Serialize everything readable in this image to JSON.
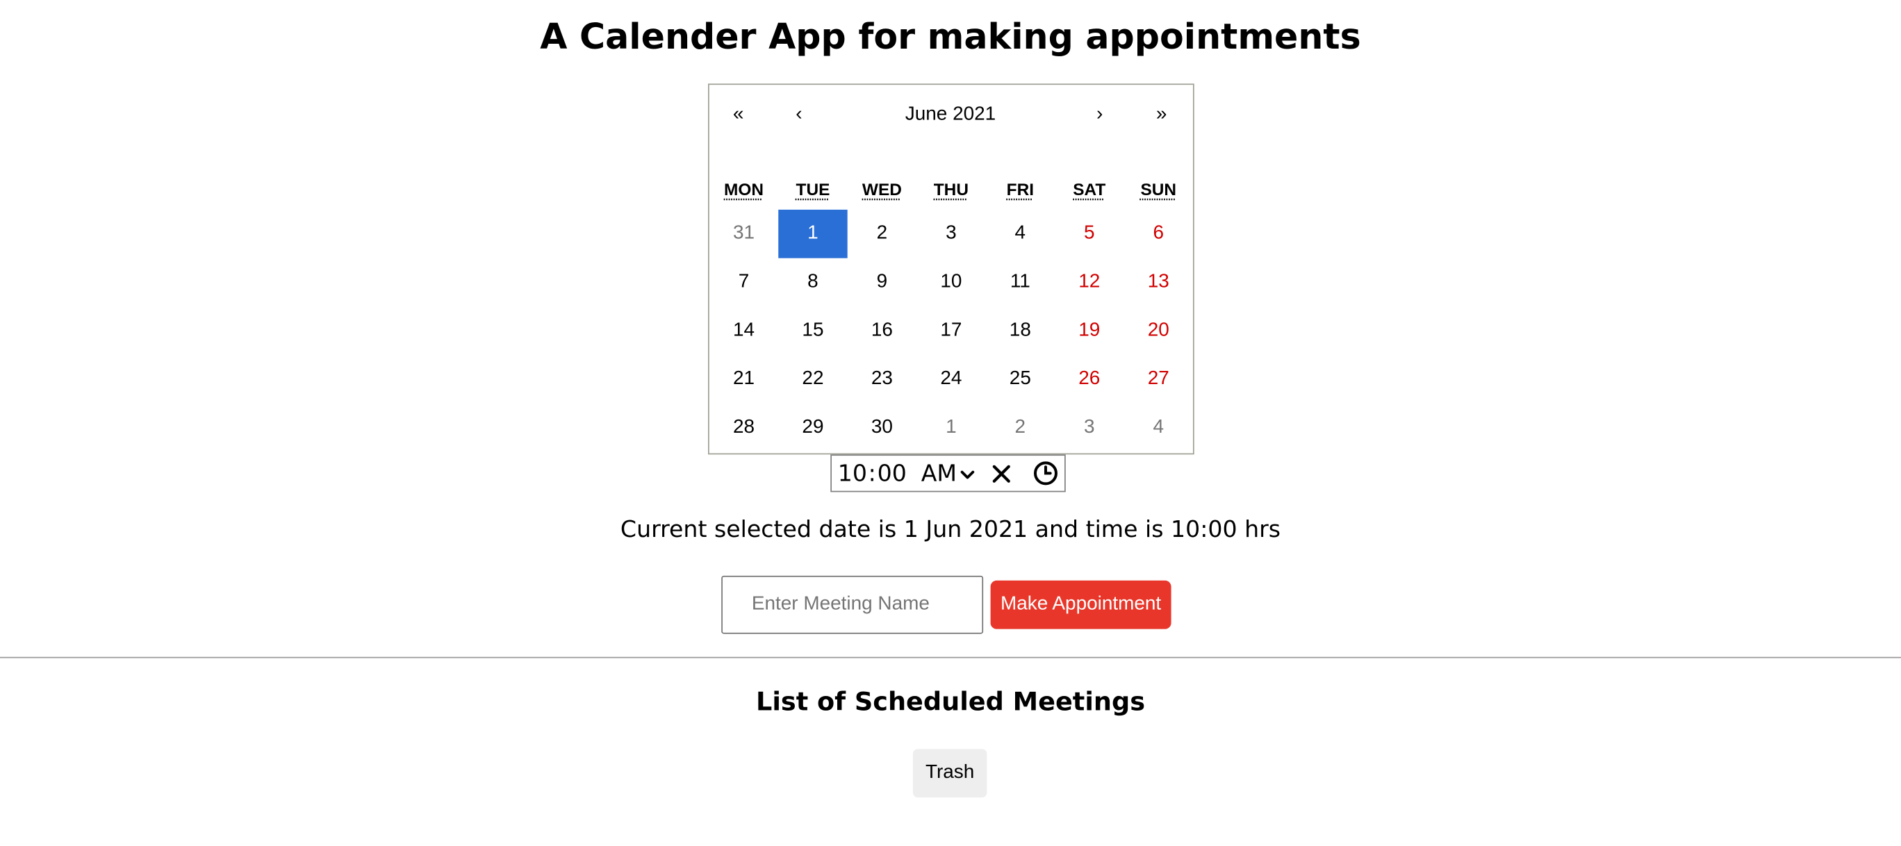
{
  "page": {
    "title": "A Calender App for making appointments"
  },
  "calendar": {
    "nav": {
      "prev2": "«",
      "prev": "‹",
      "label": "June 2021",
      "next": "›",
      "next2": "»"
    },
    "weekdays": [
      "MON",
      "TUE",
      "WED",
      "THU",
      "FRI",
      "SAT",
      "SUN"
    ],
    "weeks": [
      [
        {
          "label": "31",
          "kind": "neighbor"
        },
        {
          "label": "1",
          "kind": "selected"
        },
        {
          "label": "2",
          "kind": "normal"
        },
        {
          "label": "3",
          "kind": "normal"
        },
        {
          "label": "4",
          "kind": "normal"
        },
        {
          "label": "5",
          "kind": "weekend"
        },
        {
          "label": "6",
          "kind": "weekend"
        }
      ],
      [
        {
          "label": "7",
          "kind": "normal"
        },
        {
          "label": "8",
          "kind": "normal"
        },
        {
          "label": "9",
          "kind": "normal"
        },
        {
          "label": "10",
          "kind": "normal"
        },
        {
          "label": "11",
          "kind": "normal"
        },
        {
          "label": "12",
          "kind": "weekend"
        },
        {
          "label": "13",
          "kind": "weekend"
        }
      ],
      [
        {
          "label": "14",
          "kind": "normal"
        },
        {
          "label": "15",
          "kind": "normal"
        },
        {
          "label": "16",
          "kind": "normal"
        },
        {
          "label": "17",
          "kind": "normal"
        },
        {
          "label": "18",
          "kind": "normal"
        },
        {
          "label": "19",
          "kind": "weekend"
        },
        {
          "label": "20",
          "kind": "weekend"
        }
      ],
      [
        {
          "label": "21",
          "kind": "normal"
        },
        {
          "label": "22",
          "kind": "normal"
        },
        {
          "label": "23",
          "kind": "normal"
        },
        {
          "label": "24",
          "kind": "normal"
        },
        {
          "label": "25",
          "kind": "normal"
        },
        {
          "label": "26",
          "kind": "weekend"
        },
        {
          "label": "27",
          "kind": "weekend"
        }
      ],
      [
        {
          "label": "28",
          "kind": "normal"
        },
        {
          "label": "29",
          "kind": "normal"
        },
        {
          "label": "30",
          "kind": "normal"
        },
        {
          "label": "1",
          "kind": "neighbor"
        },
        {
          "label": "2",
          "kind": "neighbor"
        },
        {
          "label": "3",
          "kind": "neighbor"
        },
        {
          "label": "4",
          "kind": "neighbor"
        }
      ]
    ]
  },
  "time_picker": {
    "hour": "10",
    "separator": ":",
    "minute": "00",
    "ampm": "AM",
    "clear_icon": "close-icon",
    "clock_icon": "clock-icon"
  },
  "status": {
    "text": "Current selected date is 1 Jun 2021 and time is 10:00 hrs"
  },
  "form": {
    "input_placeholder": "Enter Meeting Name",
    "input_value": "",
    "submit_label": "Make Appointment"
  },
  "list": {
    "title": "List of Scheduled Meetings",
    "trash_label": "Trash"
  },
  "colors": {
    "selected_day": "#2a6fd6",
    "weekend_text": "#d10000",
    "neighbor_text": "#757575",
    "primary_button": "#e8372a",
    "secondary_button": "#eeeeee"
  }
}
